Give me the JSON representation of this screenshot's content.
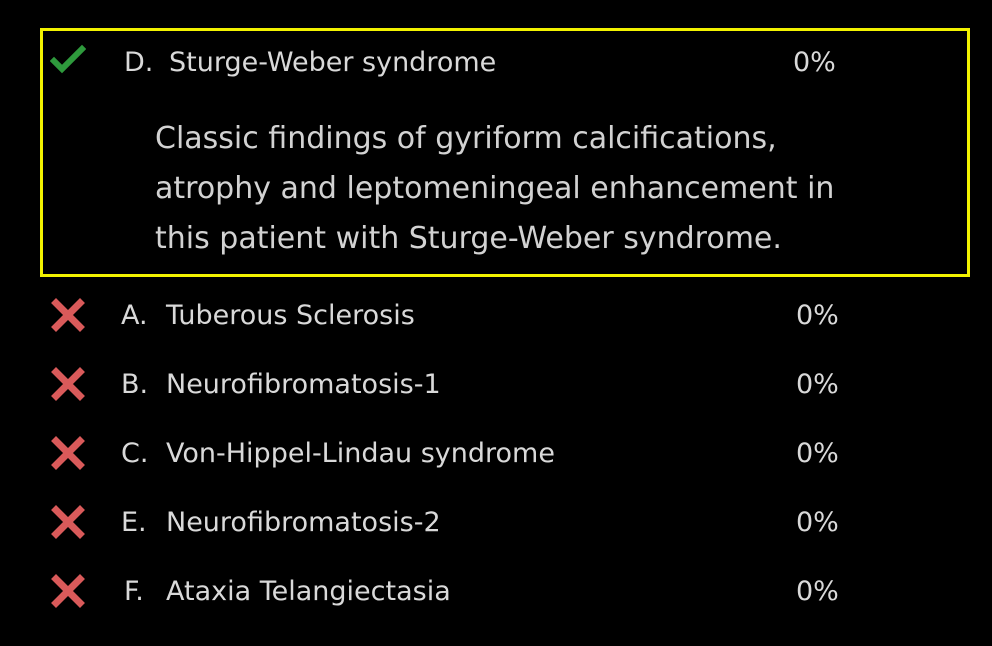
{
  "correct_answer": {
    "letter": "D.",
    "text": "Sturge-Weber syndrome",
    "percent": "0%",
    "icon": "checkmark-icon",
    "icon_color": "#2e9a3c",
    "explanation": "Classic findings of gyriform calcifications,\natrophy and leptomeningeal enhancement in\nthis patient with Sturge-Weber syndrome.",
    "highlight_color": "#f2f200"
  },
  "incorrect_answers": [
    {
      "letter": "A.",
      "text": "Tuberous Sclerosis",
      "percent": "0%",
      "icon": "x-mark-icon"
    },
    {
      "letter": "B.",
      "text": "Neurofibromatosis-1",
      "percent": "0%",
      "icon": "x-mark-icon"
    },
    {
      "letter": "C.",
      "text": "Von-Hippel-Lindau syndrome",
      "percent": "0%",
      "icon": "x-mark-icon"
    },
    {
      "letter": "E.",
      "text": "Neurofibromatosis-2",
      "percent": "0%",
      "icon": "x-mark-icon"
    },
    {
      "letter": "F.",
      "text": "Ataxia Telangiectasia",
      "percent": "0%",
      "icon": "x-mark-icon"
    }
  ],
  "colors": {
    "background": "#000000",
    "text": "#d9d9d9",
    "incorrect_icon": "#d95a5a"
  }
}
